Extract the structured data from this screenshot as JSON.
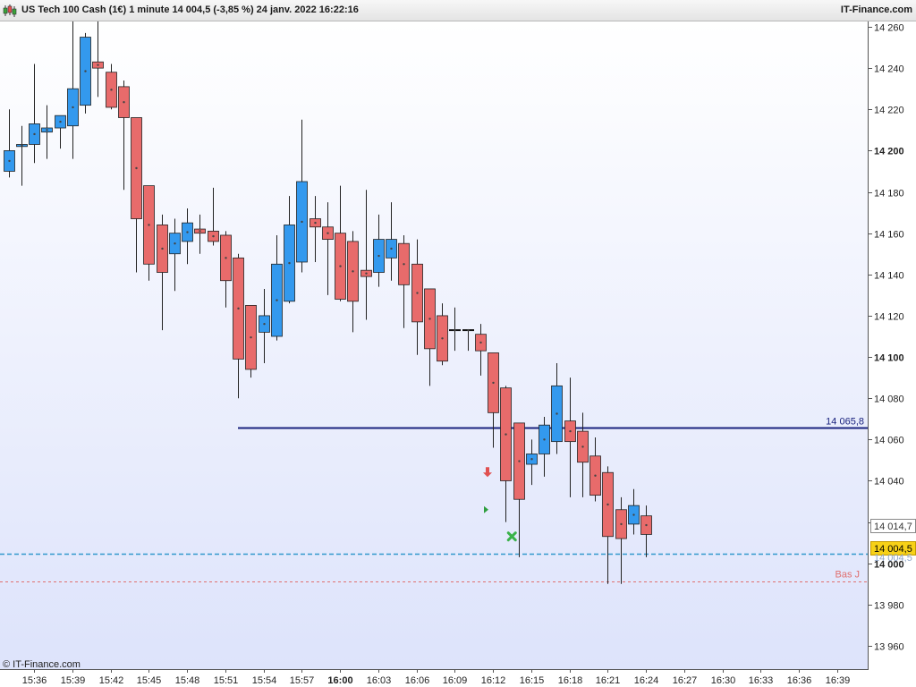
{
  "header": {
    "title": "US Tech 100 Cash (1€) 1 minute 14 004,5 (-3,85 %) 24 janv. 2022 16:22:16",
    "brand": "IT-Finance.com"
  },
  "footer": {
    "copyright": "© IT-Finance.com"
  },
  "colors": {
    "bull": "#3399ee",
    "bear": "#e86b6b",
    "wick": "#222222",
    "support_line": "#1a237e",
    "price_line": "#3399cc",
    "low_line": "#e07070",
    "background_top": "#ffffff",
    "background_bottom": "#dde3fb"
  },
  "chart_data": {
    "type": "candlestick",
    "instrument": "US Tech 100 Cash (1€)",
    "timeframe": "1 minute",
    "ylim": [
      13948,
      14263
    ],
    "y_ticks": [
      {
        "value": 13960,
        "label": "13 960",
        "bold": false
      },
      {
        "value": 13980,
        "label": "13 980",
        "bold": false
      },
      {
        "value": 14000,
        "label": "14 000",
        "bold": true
      },
      {
        "value": 14020,
        "label": "14 020",
        "bold": false
      },
      {
        "value": 14040,
        "label": "14 040",
        "bold": false
      },
      {
        "value": 14060,
        "label": "14 060",
        "bold": false
      },
      {
        "value": 14080,
        "label": "14 080",
        "bold": false
      },
      {
        "value": 14100,
        "label": "14 100",
        "bold": true
      },
      {
        "value": 14120,
        "label": "14 120",
        "bold": false
      },
      {
        "value": 14140,
        "label": "14 140",
        "bold": false
      },
      {
        "value": 14160,
        "label": "14 160",
        "bold": false
      },
      {
        "value": 14180,
        "label": "14 180",
        "bold": false
      },
      {
        "value": 14200,
        "label": "14 200",
        "bold": true
      },
      {
        "value": 14220,
        "label": "14 220",
        "bold": false
      },
      {
        "value": 14240,
        "label": "14 240",
        "bold": false
      },
      {
        "value": 14260,
        "label": "14 260",
        "bold": false
      }
    ],
    "x_ticks": [
      {
        "index": 2,
        "label": "15:36",
        "bold": false
      },
      {
        "index": 5,
        "label": "15:39",
        "bold": false
      },
      {
        "index": 8,
        "label": "15:42",
        "bold": false
      },
      {
        "index": 11,
        "label": "15:45",
        "bold": false
      },
      {
        "index": 14,
        "label": "15:48",
        "bold": false
      },
      {
        "index": 17,
        "label": "15:51",
        "bold": false
      },
      {
        "index": 20,
        "label": "15:54",
        "bold": false
      },
      {
        "index": 23,
        "label": "15:57",
        "bold": false
      },
      {
        "index": 26,
        "label": "16:00",
        "bold": true
      },
      {
        "index": 29,
        "label": "16:03",
        "bold": false
      },
      {
        "index": 32,
        "label": "16:06",
        "bold": false
      },
      {
        "index": 35,
        "label": "16:09",
        "bold": false
      },
      {
        "index": 38,
        "label": "16:12",
        "bold": false
      },
      {
        "index": 41,
        "label": "16:15",
        "bold": false
      },
      {
        "index": 44,
        "label": "16:18",
        "bold": false
      },
      {
        "index": 47,
        "label": "16:21",
        "bold": false
      },
      {
        "index": 50,
        "label": "16:24",
        "bold": false
      },
      {
        "index": 53,
        "label": "16:27",
        "bold": false
      },
      {
        "index": 56,
        "label": "16:30",
        "bold": false
      },
      {
        "index": 59,
        "label": "16:33",
        "bold": false
      },
      {
        "index": 62,
        "label": "16:36",
        "bold": false
      },
      {
        "index": 65,
        "label": "16:39",
        "bold": false
      }
    ],
    "candles": [
      {
        "index": 0,
        "open": 14190,
        "high": 14220,
        "low": 14187,
        "close": 14200
      },
      {
        "index": 1,
        "open": 14202,
        "high": 14212,
        "low": 14183,
        "close": 14203
      },
      {
        "index": 2,
        "open": 14203,
        "high": 14242,
        "low": 14194,
        "close": 14213
      },
      {
        "index": 3,
        "open": 14209,
        "high": 14222,
        "low": 14196,
        "close": 14211
      },
      {
        "index": 4,
        "open": 14211,
        "high": 14217,
        "low": 14201,
        "close": 14217
      },
      {
        "index": 5,
        "open": 14212,
        "high": 14263,
        "low": 14196,
        "close": 14230
      },
      {
        "index": 6,
        "open": 14222,
        "high": 14257,
        "low": 14218,
        "close": 14255
      },
      {
        "index": 7,
        "open": 14243,
        "high": 14263,
        "low": 14226,
        "close": 14240
      },
      {
        "index": 8,
        "open": 14238,
        "high": 14242,
        "low": 14220,
        "close": 14221
      },
      {
        "index": 9,
        "open": 14231,
        "high": 14234,
        "low": 14181,
        "close": 14216
      },
      {
        "index": 10,
        "open": 14216,
        "high": 14216,
        "low": 14141,
        "close": 14167
      },
      {
        "index": 11,
        "open": 14183,
        "high": 14183,
        "low": 14137,
        "close": 14145
      },
      {
        "index": 12,
        "open": 14164,
        "high": 14169,
        "low": 14113,
        "close": 14141
      },
      {
        "index": 13,
        "open": 14150,
        "high": 14167,
        "low": 14132,
        "close": 14160
      },
      {
        "index": 14,
        "open": 14156,
        "high": 14172,
        "low": 14145,
        "close": 14165
      },
      {
        "index": 15,
        "open": 14162,
        "high": 14169,
        "low": 14150,
        "close": 14160
      },
      {
        "index": 16,
        "open": 14161,
        "high": 14182,
        "low": 14154,
        "close": 14156
      },
      {
        "index": 17,
        "open": 14159,
        "high": 14161,
        "low": 14124,
        "close": 14137
      },
      {
        "index": 18,
        "open": 14148,
        "high": 14150,
        "low": 14080,
        "close": 14099
      },
      {
        "index": 19,
        "open": 14125,
        "high": 14125,
        "low": 14090,
        "close": 14094
      },
      {
        "index": 20,
        "open": 14112,
        "high": 14133,
        "low": 14097,
        "close": 14120
      },
      {
        "index": 21,
        "open": 14110,
        "high": 14159,
        "low": 14108,
        "close": 14145
      },
      {
        "index": 22,
        "open": 14127,
        "high": 14178,
        "low": 14126,
        "close": 14164
      },
      {
        "index": 23,
        "open": 14146,
        "high": 14215,
        "low": 14141,
        "close": 14185
      },
      {
        "index": 24,
        "open": 14167,
        "high": 14178,
        "low": 14146,
        "close": 14163
      },
      {
        "index": 25,
        "open": 14163,
        "high": 14175,
        "low": 14130,
        "close": 14157
      },
      {
        "index": 26,
        "open": 14160,
        "high": 14183,
        "low": 14127,
        "close": 14128
      },
      {
        "index": 27,
        "open": 14156,
        "high": 14161,
        "low": 14112,
        "close": 14127
      },
      {
        "index": 28,
        "open": 14142,
        "high": 14181,
        "low": 14118,
        "close": 14139
      },
      {
        "index": 29,
        "open": 14141,
        "high": 14169,
        "low": 14134,
        "close": 14157
      },
      {
        "index": 30,
        "open": 14148,
        "high": 14175,
        "low": 14137,
        "close": 14157
      },
      {
        "index": 31,
        "open": 14155,
        "high": 14159,
        "low": 14114,
        "close": 14135
      },
      {
        "index": 32,
        "open": 14145,
        "high": 14157,
        "low": 14101,
        "close": 14117
      },
      {
        "index": 33,
        "open": 14133,
        "high": 14133,
        "low": 14086,
        "close": 14104
      },
      {
        "index": 34,
        "open": 14120,
        "high": 14126,
        "low": 14096,
        "close": 14098
      },
      {
        "index": 35,
        "open": 14113,
        "high": 14124,
        "low": 14103,
        "close": 14113
      },
      {
        "index": 36,
        "open": 14113,
        "high": 14113,
        "low": 14103,
        "close": 14113
      },
      {
        "index": 37,
        "open": 14111,
        "high": 14116,
        "low": 14091,
        "close": 14103
      },
      {
        "index": 38,
        "open": 14102,
        "high": 14102,
        "low": 14056,
        "close": 14073
      },
      {
        "index": 39,
        "open": 14085,
        "high": 14086,
        "low": 14020,
        "close": 14040
      },
      {
        "index": 40,
        "open": 14068,
        "high": 14068,
        "low": 14003,
        "close": 14031
      },
      {
        "index": 41,
        "open": 14048,
        "high": 14060,
        "low": 14038,
        "close": 14053
      },
      {
        "index": 42,
        "open": 14053,
        "high": 14071,
        "low": 14042,
        "close": 14067
      },
      {
        "index": 43,
        "open": 14059,
        "high": 14097,
        "low": 14053,
        "close": 14086
      },
      {
        "index": 44,
        "open": 14069,
        "high": 14090,
        "low": 14032,
        "close": 14059
      },
      {
        "index": 45,
        "open": 14064,
        "high": 14073,
        "low": 14032,
        "close": 14049
      },
      {
        "index": 46,
        "open": 14052,
        "high": 14061,
        "low": 14030,
        "close": 14033
      },
      {
        "index": 47,
        "open": 14044,
        "high": 14047,
        "low": 13990,
        "close": 14013
      },
      {
        "index": 48,
        "open": 14026,
        "high": 14032,
        "low": 13990,
        "close": 14012
      },
      {
        "index": 49,
        "open": 14019,
        "high": 14036,
        "low": 14014,
        "close": 14028
      },
      {
        "index": 50,
        "open": 14023,
        "high": 14028,
        "low": 14003,
        "close": 14014
      }
    ],
    "horizontal_lines": [
      {
        "name": "support",
        "value": 14065.8,
        "label": "14 065,8",
        "style": "solid"
      },
      {
        "name": "last-price",
        "value": 14004.5,
        "label": "14 004,5",
        "style": "dashed"
      },
      {
        "name": "day-low",
        "value": 13991,
        "label": "Bas J",
        "style": "dashed"
      }
    ],
    "price_tags": [
      {
        "name": "secondary-price-tag",
        "value": 14014.7,
        "label": "14 014,7"
      },
      {
        "name": "last-price-tag",
        "value": 14004.5,
        "label": "14 004,5"
      },
      {
        "name": "shadow-price-tag",
        "value": 14004.5,
        "label": "14 004,5"
      }
    ],
    "markers": [
      {
        "name": "sell-arrow-icon",
        "index": 38,
        "value": 14044,
        "shape": "down-arrow",
        "color": "#e05050"
      },
      {
        "name": "play-marker-icon",
        "index": 38,
        "value": 14026,
        "shape": "triangle-right",
        "color": "#2e9e3e"
      },
      {
        "name": "cross-marker-icon",
        "index": 39,
        "value": 14013,
        "shape": "cross",
        "color": "#3ab24a"
      }
    ]
  }
}
